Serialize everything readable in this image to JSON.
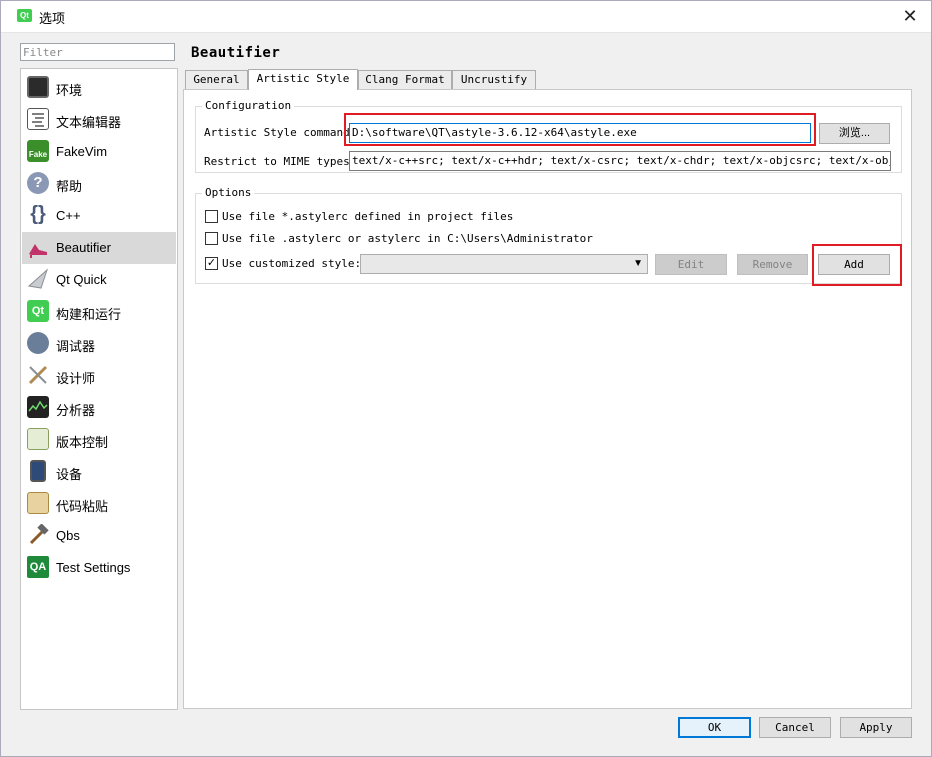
{
  "window": {
    "title": "选项",
    "app_icon_text": "Qt"
  },
  "filter": {
    "placeholder": "Filter"
  },
  "sidebar": {
    "items": [
      {
        "label": "环境",
        "icon": "monitor-icon",
        "color": "#333333"
      },
      {
        "label": "文本编辑器",
        "icon": "text-editor-icon",
        "color": "#555555"
      },
      {
        "label": "FakeVim",
        "icon": "fakevim-icon",
        "color": "#3a8f2a"
      },
      {
        "label": "帮助",
        "icon": "help-icon",
        "color": "#6b7a9a"
      },
      {
        "label": "C++",
        "icon": "braces-icon",
        "color": "#4a5a7a"
      },
      {
        "label": "Beautifier",
        "icon": "high-heel-icon",
        "color": "#c2336b"
      },
      {
        "label": "Qt Quick",
        "icon": "qt-quick-icon",
        "color": "#9aa0a6"
      },
      {
        "label": "构建和运行",
        "icon": "build-run-icon",
        "color": "#41cd52"
      },
      {
        "label": "调试器",
        "icon": "debugger-icon",
        "color": "#5a6e8a"
      },
      {
        "label": "设计师",
        "icon": "designer-icon",
        "color": "#b08a50"
      },
      {
        "label": "分析器",
        "icon": "analyzer-icon",
        "color": "#2a2a2a"
      },
      {
        "label": "版本控制",
        "icon": "version-control-icon",
        "color": "#8aa060"
      },
      {
        "label": "设备",
        "icon": "device-icon",
        "color": "#3a5a8a"
      },
      {
        "label": "代码粘贴",
        "icon": "code-paste-icon",
        "color": "#c7a04a"
      },
      {
        "label": "Qbs",
        "icon": "hammer-icon",
        "color": "#8a5a2a"
      },
      {
        "label": "Test Settings",
        "icon": "qa-icon",
        "color": "#1e8a3a"
      }
    ]
  },
  "page": {
    "title": "Beautifier"
  },
  "tabs": [
    {
      "label": "General"
    },
    {
      "label": "Artistic Style"
    },
    {
      "label": "Clang Format"
    },
    {
      "label": "Uncrustify"
    }
  ],
  "configuration": {
    "title": "Configuration",
    "command_label": "Artistic Style command:",
    "command_value": "D:\\software\\QT\\astyle-3.6.12-x64\\astyle.exe",
    "browse_label": "浏览...",
    "mime_label": "Restrict to MIME types:",
    "mime_value": "text/x-c++src; text/x-c++hdr; text/x-csrc; text/x-chdr; text/x-objcsrc; text/x-objc++src"
  },
  "options": {
    "title": "Options",
    "opt1_label": "Use file *.astylerc defined in project files",
    "opt2_label": "Use file .astylerc or astylerc in C:\\Users\\Administrator",
    "opt3_label": "Use customized style:",
    "style_value": "",
    "edit_label": "Edit",
    "remove_label": "Remove",
    "add_label": "Add"
  },
  "footer": {
    "ok_label": "OK",
    "cancel_label": "Cancel",
    "apply_label": "Apply"
  },
  "colors": {
    "highlight": "#e01b24",
    "selected_item": "#d9d9d9",
    "default_button_border": "#0078d7"
  }
}
